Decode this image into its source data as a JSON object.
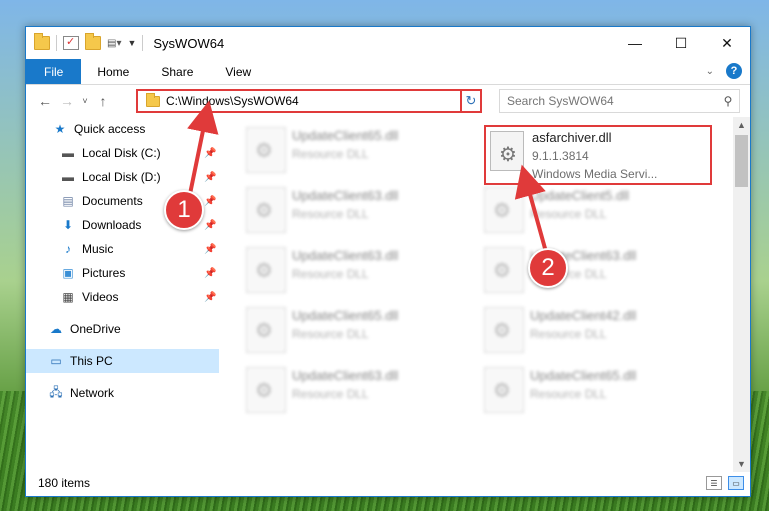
{
  "window": {
    "title": "SysWOW64",
    "controls": {
      "minimize": "—",
      "maximize": "☐",
      "close": "✕"
    }
  },
  "ribbon": {
    "tabs": [
      "File",
      "Home",
      "Share",
      "View"
    ],
    "help": "?"
  },
  "navigation": {
    "back": "←",
    "forward": "→",
    "recent": "˅",
    "up": "↑",
    "address": "C:\\Windows\\SysWOW64",
    "refresh": "↻",
    "search_placeholder": "Search SysWOW64"
  },
  "sidebar": {
    "items": [
      {
        "label": "Quick access",
        "icon": "star-icon"
      },
      {
        "label": "Local Disk (C:)",
        "icon": "drive-icon"
      },
      {
        "label": "Local Disk (D:)",
        "icon": "drive-icon"
      },
      {
        "label": "Documents",
        "icon": "documents-icon"
      },
      {
        "label": "Downloads",
        "icon": "download-icon"
      },
      {
        "label": "Music",
        "icon": "music-icon"
      },
      {
        "label": "Pictures",
        "icon": "pictures-icon"
      },
      {
        "label": "Videos",
        "icon": "videos-icon"
      },
      {
        "label": "OneDrive",
        "icon": "cloud-icon"
      },
      {
        "label": "This PC",
        "icon": "computer-icon"
      },
      {
        "label": "Network",
        "icon": "network-icon"
      }
    ]
  },
  "files": [
    {
      "name": "UpdateClient65.dll",
      "sub": "Resource DLL"
    },
    {
      "name": "asfarchiver.dll",
      "sub": "9.1.1.3814",
      "sub2": "Windows Media Servi..."
    },
    {
      "name": "UpdateClient63.dll",
      "sub": "Resource DLL"
    },
    {
      "name": "UpdateClient5.dll",
      "sub": "Resource DLL"
    },
    {
      "name": "UpdateClient63.dll",
      "sub": "Resource DLL"
    },
    {
      "name": "UpdateClient63.dll",
      "sub": "Resource DLL"
    },
    {
      "name": "UpdateClient65.dll",
      "sub": "Resource DLL"
    },
    {
      "name": "UpdateClient42.dll",
      "sub": "Resource DLL"
    },
    {
      "name": "UpdateClient63.dll",
      "sub": "Resource DLL"
    },
    {
      "name": "UpdateClient65.dll",
      "sub": "Resource DLL"
    }
  ],
  "status": {
    "count": "180 items"
  },
  "callouts": [
    "1",
    "2"
  ],
  "colors": {
    "accent": "#1979ca",
    "highlight": "#e03a3a",
    "selected": "#cce8ff"
  }
}
